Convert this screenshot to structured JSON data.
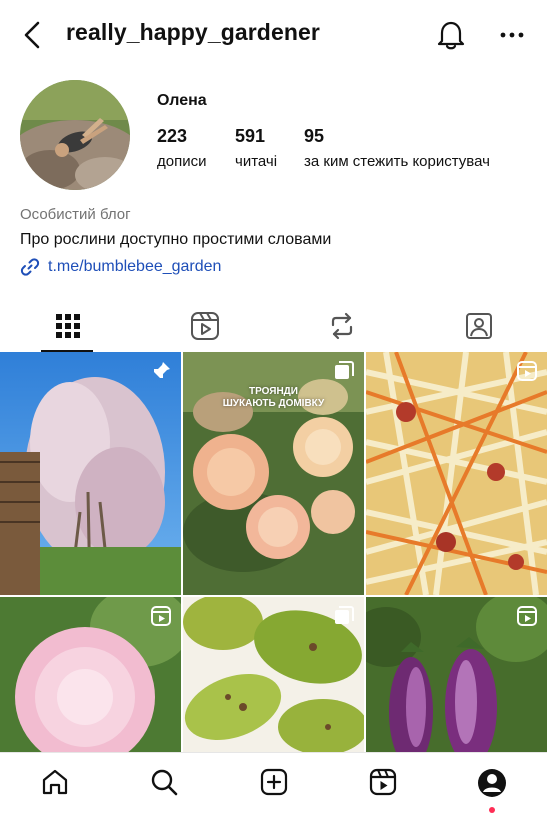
{
  "header": {
    "username": "really_happy_gardener",
    "back_icon": "chevron-left-icon",
    "notifications_icon": "bell-icon",
    "more_icon": "more-horizontal-icon"
  },
  "profile": {
    "name": "Олена",
    "stats": [
      {
        "value": "223",
        "label": "дописи"
      },
      {
        "value": "591",
        "label": "читачі"
      },
      {
        "value": "95",
        "label": "за ким стежить користувач"
      }
    ],
    "category": "Особистий блог",
    "bio": "Про рослини доступно простими словами",
    "link": "t.me/bumblebee_garden"
  },
  "tabs": [
    {
      "icon": "grid-icon",
      "active": true
    },
    {
      "icon": "reels-icon",
      "active": false
    },
    {
      "icon": "reposts-icon",
      "active": false
    },
    {
      "icon": "tagged-icon",
      "active": false
    }
  ],
  "posts": [
    {
      "subject": "flowering tamarisk shrub",
      "badge": "pin-icon"
    },
    {
      "subject": "peach roses",
      "badge": "carousel-icon",
      "caption_line1": "ТРОЯНДИ",
      "caption_line2": "ШУКАЮТЬ ДОМІВКУ"
    },
    {
      "subject": "shredded cabbage and carrots",
      "badge": "reels-icon"
    },
    {
      "subject": "pink peony",
      "badge": "reels-icon"
    },
    {
      "subject": "green tomato slices",
      "badge": "carousel-icon"
    },
    {
      "subject": "purple eggplants",
      "badge": "reels-icon"
    }
  ],
  "bottom_nav": [
    "home-icon",
    "search-icon",
    "create-icon",
    "reels-icon",
    "profile-icon"
  ],
  "colors": {
    "link": "#1f4fb8",
    "notification_dot": "#ff2d55",
    "secondary_text": "#737373"
  }
}
